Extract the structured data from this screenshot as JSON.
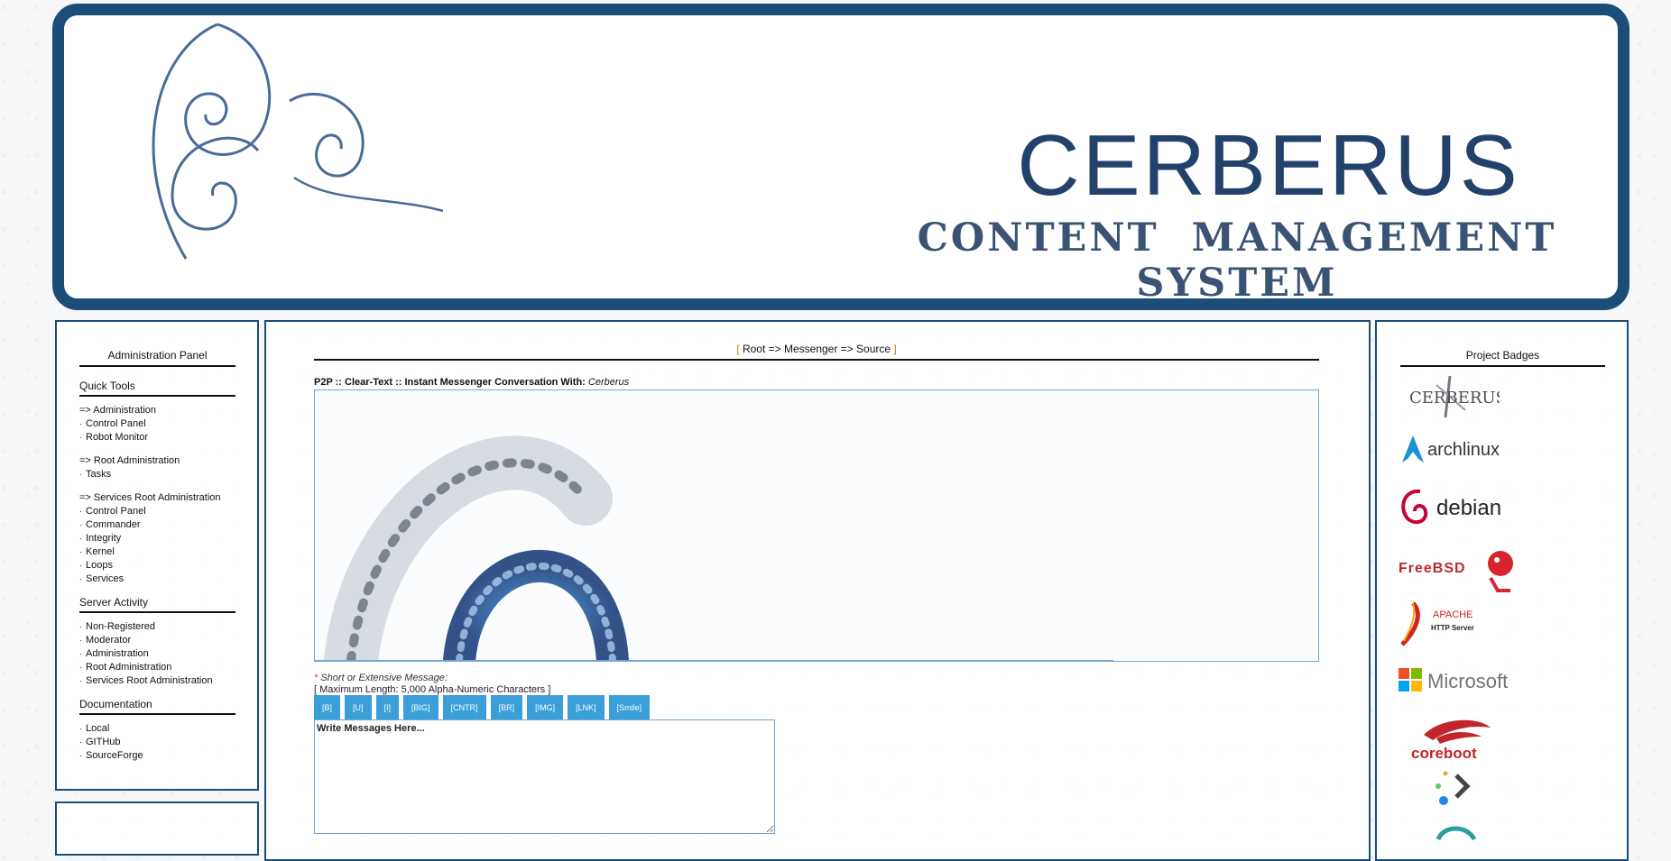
{
  "banner": {
    "title": "CERBERUS",
    "subtitle": "CONTENT MANAGEMENT SYSTEM"
  },
  "left_panel": {
    "heading": "Administration Panel",
    "quick_tools_title": "Quick Tools",
    "groups": [
      {
        "header": "=> Administration",
        "items": [
          "Control Panel",
          "Robot Monitor"
        ]
      },
      {
        "header": "=> Root Administration",
        "items": [
          "Tasks"
        ]
      },
      {
        "header": "=> Services Root Administration",
        "items": [
          "Control Panel",
          "Commander",
          "Integrity",
          "Kernel",
          "Loops",
          "Services"
        ]
      }
    ],
    "server_activity_title": "Server Activity",
    "server_activity": [
      "Non-Registered",
      "Moderator",
      "Administration",
      "Root Administration",
      "Services Root Administration"
    ],
    "documentation_title": "Documentation",
    "documentation": [
      "Local",
      "GITHub",
      "SourceForge"
    ],
    "bullet": "·"
  },
  "main": {
    "breadcrumb": {
      "open": "[",
      "text": "Root => Messenger => Source",
      "close": "]"
    },
    "convo_heading_prefix": "P2P :: Clear-Text :: Instant Messenger Conversation With:",
    "convo_partner": "Cerberus",
    "message_label_star": "*",
    "message_label": "Short or Extensive Message:",
    "message_limit": "[ Maximum Length: 5,000 Alpha-Numeric Characters ]",
    "toolbar": [
      "[B]",
      "[U]",
      "[I]",
      "[BIG]",
      "[CNTR]",
      "[BR]",
      "[IMG]",
      "[LNK]",
      "[Smile]"
    ],
    "message_placeholder": "Write Messages Here..."
  },
  "right_panel": {
    "heading": "Project Badges",
    "badges": {
      "cerberus": "CERBERUS",
      "arch": "archlinux",
      "debian": "debian",
      "freebsd": "FreeBSD",
      "apache_1": "APACHE",
      "apache_2": "HTTP Server",
      "microsoft": "Microsoft",
      "coreboot": "coreboot"
    }
  },
  "colors": {
    "frame": "#1b4d78",
    "title": "#23426b",
    "toolbar": "#3a9fd8",
    "accent": "#6fa8d6"
  }
}
